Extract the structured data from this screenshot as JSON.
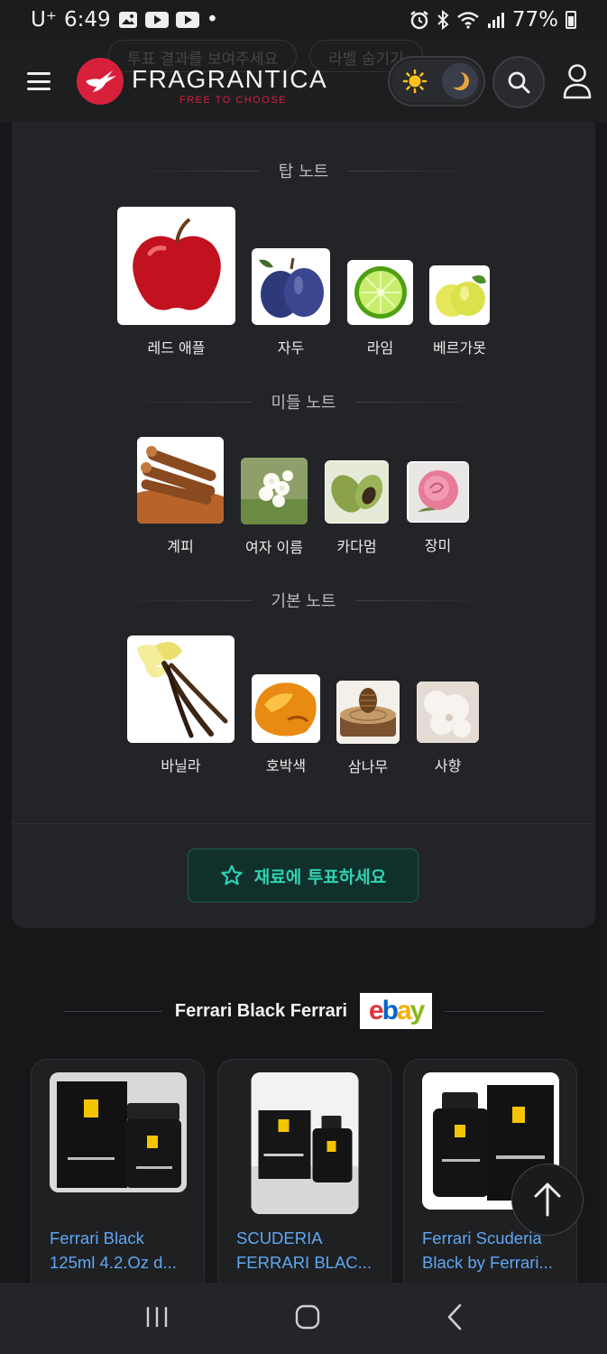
{
  "status_bar": {
    "carrier": "U⁺",
    "time": "6:49",
    "dot": "•",
    "battery": "77%"
  },
  "header": {
    "ghost_tabs": [
      "투표 결과를 보여주세요",
      "라벨 숨기기"
    ],
    "logo_text": "FRAGRANTICA",
    "logo_tagline": "FREE TO CHOOSE",
    "brand_color": "#d8203b"
  },
  "notes": {
    "top": {
      "heading": "탑 노트",
      "items": [
        {
          "label": "레드 애플",
          "icon": "red-apple"
        },
        {
          "label": "자두",
          "icon": "plum"
        },
        {
          "label": "라임",
          "icon": "lime"
        },
        {
          "label": "베르가못",
          "icon": "bergamot"
        }
      ]
    },
    "middle": {
      "heading": "미들 노트",
      "items": [
        {
          "label": "계피",
          "icon": "cinnamon"
        },
        {
          "label": "여자 이름",
          "icon": "jasmine"
        },
        {
          "label": "카다멈",
          "icon": "cardamom"
        },
        {
          "label": "장미",
          "icon": "rose"
        }
      ]
    },
    "base": {
      "heading": "기본 노트",
      "items": [
        {
          "label": "바닐라",
          "icon": "vanilla"
        },
        {
          "label": "호박색",
          "icon": "amber"
        },
        {
          "label": "삼나무",
          "icon": "cedar"
        },
        {
          "label": "사향",
          "icon": "musk"
        }
      ]
    },
    "vote_button": "재료에 투표하세요",
    "accent_color": "#2fd3b4"
  },
  "ebay": {
    "title": "Ferrari Black Ferrari",
    "logo_letters": [
      "e",
      "b",
      "a",
      "y"
    ],
    "logo_colors": [
      "#e53238",
      "#0064d2",
      "#f5af02",
      "#86b817"
    ],
    "products": [
      {
        "line1": "Ferrari Black",
        "line2": "125ml 4.2.Oz d..."
      },
      {
        "line1": "SCUDERIA",
        "line2": "FERRARI BLAC..."
      },
      {
        "line1": "Ferrari Scuderia",
        "line2": "Black by Ferrari..."
      }
    ]
  }
}
